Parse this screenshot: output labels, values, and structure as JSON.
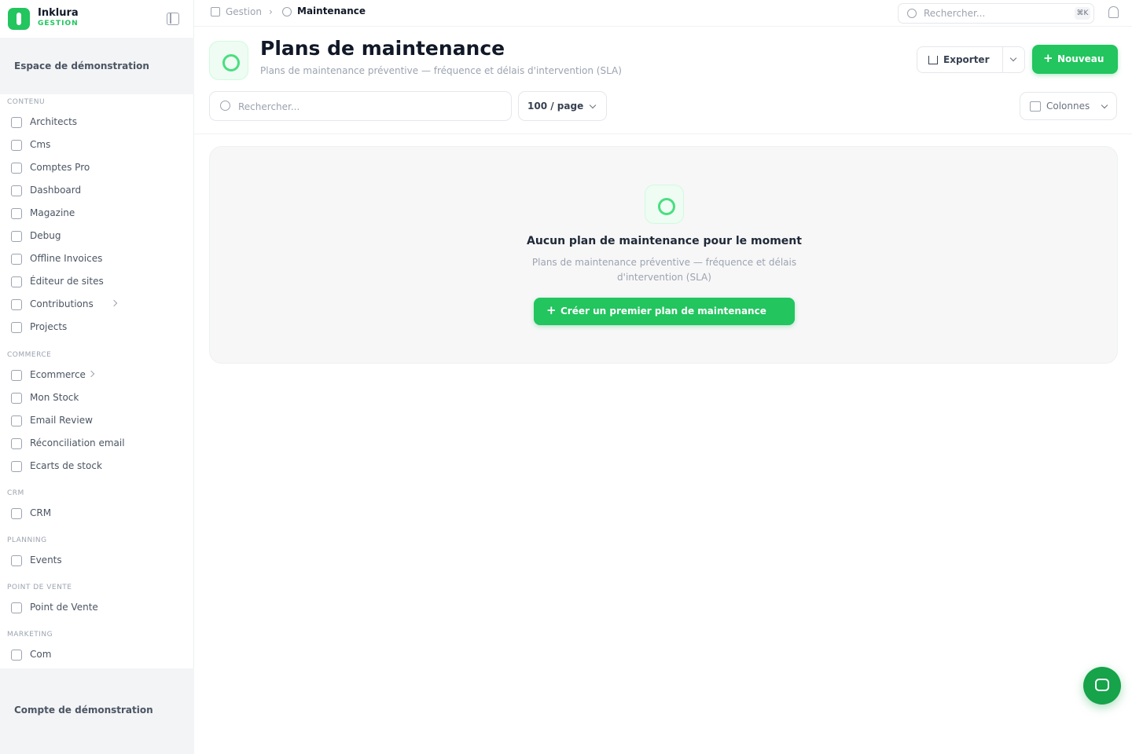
{
  "brand": {
    "name": "Inklura",
    "subtitle": "GESTION"
  },
  "sidebar": {
    "workspace": "Espace de démonstration",
    "account": "Compte de démonstration",
    "sections": [
      {
        "title": "CONTENU",
        "items": [
          {
            "label": "Architects",
            "icon": "building-icon"
          },
          {
            "label": "Cms",
            "icon": "document-icon"
          },
          {
            "label": "Comptes Pro",
            "icon": "document-icon"
          },
          {
            "label": "Dashboard",
            "icon": "grid-icon"
          },
          {
            "label": "Magazine",
            "icon": "newspaper-icon"
          },
          {
            "label": "Debug",
            "icon": "newspaper-icon"
          },
          {
            "label": "Offline Invoices",
            "icon": "newspaper-icon"
          },
          {
            "label": "Éditeur de sites",
            "icon": "terminal-icon"
          },
          {
            "label": "Contributions",
            "icon": "chat-icon",
            "has_children": true
          },
          {
            "label": "Projects",
            "icon": "folder-icon"
          }
        ]
      },
      {
        "title": "COMMERCE",
        "items": [
          {
            "label": "Ecommerce",
            "icon": "cart-icon",
            "has_children": true
          },
          {
            "label": "Mon Stock",
            "icon": "cart-icon"
          },
          {
            "label": "Email Review",
            "icon": "cart-icon"
          },
          {
            "label": "Réconciliation email",
            "icon": "cart-icon"
          },
          {
            "label": "Ecarts de stock",
            "icon": "cart-icon"
          }
        ]
      },
      {
        "title": "CRM",
        "items": [
          {
            "label": "CRM",
            "icon": "users-icon"
          }
        ]
      },
      {
        "title": "PLANNING",
        "items": [
          {
            "label": "Events",
            "icon": "calendar-icon"
          }
        ]
      },
      {
        "title": "POINT DE VENTE",
        "items": [
          {
            "label": "Point de Vente",
            "icon": "store-icon"
          }
        ]
      },
      {
        "title": "MARKETING",
        "items": [
          {
            "label": "Com",
            "icon": "megaphone-icon"
          }
        ]
      }
    ]
  },
  "topbar": {
    "breadcrumb_root": "Gestion",
    "breadcrumb_sep": "›",
    "breadcrumb_current": "Maintenance",
    "search_placeholder": "Rechercher...",
    "search_shortcut": "⌘K"
  },
  "header": {
    "title": "Plans de maintenance",
    "subtitle": "Plans de maintenance préventive — fréquence et délais d'intervention (SLA)",
    "export_label": "Exporter",
    "new_label": "Nouveau"
  },
  "toolbar": {
    "search_placeholder": "Rechercher...",
    "per_page": "100 / page",
    "columns_label": "Colonnes"
  },
  "empty_state": {
    "title": "Aucun plan de maintenance pour le moment",
    "description": "Plans de maintenance préventive — fréquence et délais d'intervention (SLA)",
    "cta_label": "Créer un premier plan de maintenance"
  },
  "colors": {
    "accent": "#22c55e",
    "accent_dark": "#16a34a",
    "muted": "#9ca3af"
  }
}
